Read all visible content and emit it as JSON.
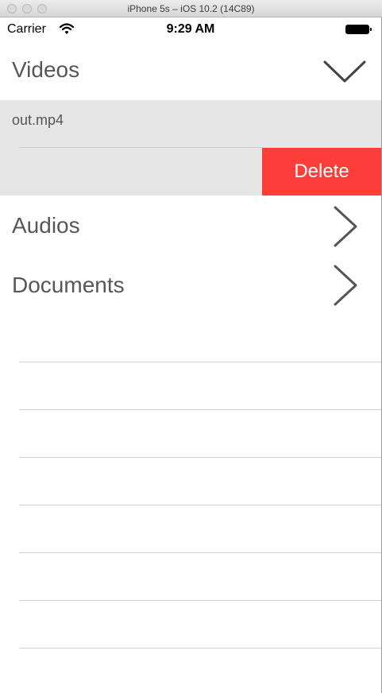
{
  "window": {
    "title": "iPhone 5s – iOS 10.2 (14C89)"
  },
  "status_bar": {
    "carrier": "Carrier",
    "time": "9:29 AM"
  },
  "sections": {
    "videos": {
      "label": "Videos",
      "expanded": true,
      "icon": "chevron-down-icon"
    },
    "audios": {
      "label": "Audios",
      "expanded": false,
      "icon": "chevron-right-icon"
    },
    "documents": {
      "label": "Documents",
      "expanded": false,
      "icon": "chevron-right-icon"
    }
  },
  "videos_files": [
    {
      "name": "out.mp4",
      "swipe_action": "Delete"
    }
  ],
  "colors": {
    "delete": "#fc3d39",
    "selected_row": "#e6e6e6",
    "section_text": "#575757"
  }
}
